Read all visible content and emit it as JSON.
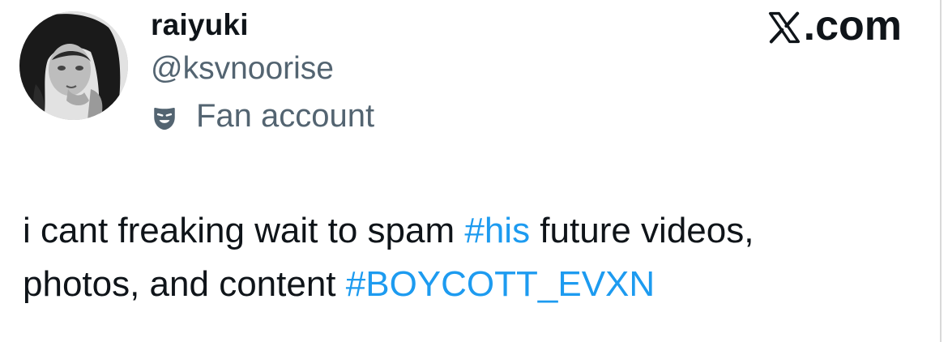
{
  "author": {
    "display_name": "raiyuki",
    "handle": "@ksvnoorise",
    "badge_label": "Fan account",
    "badge_icon": "theater-mask-icon",
    "avatar": "profile-avatar"
  },
  "brand": {
    "text": ".com",
    "icon": "x-logo-icon"
  },
  "tweet": {
    "line1_before": "i cant freaking wait to spam ",
    "hashtag1": "#his",
    "line1_after": " future videos,",
    "line2_before": "photos, and content ",
    "hashtag2": "#BOYCOTT_EVXN"
  },
  "colors": {
    "text": "#0f1419",
    "secondary": "#536471",
    "link": "#1d9bf0"
  }
}
